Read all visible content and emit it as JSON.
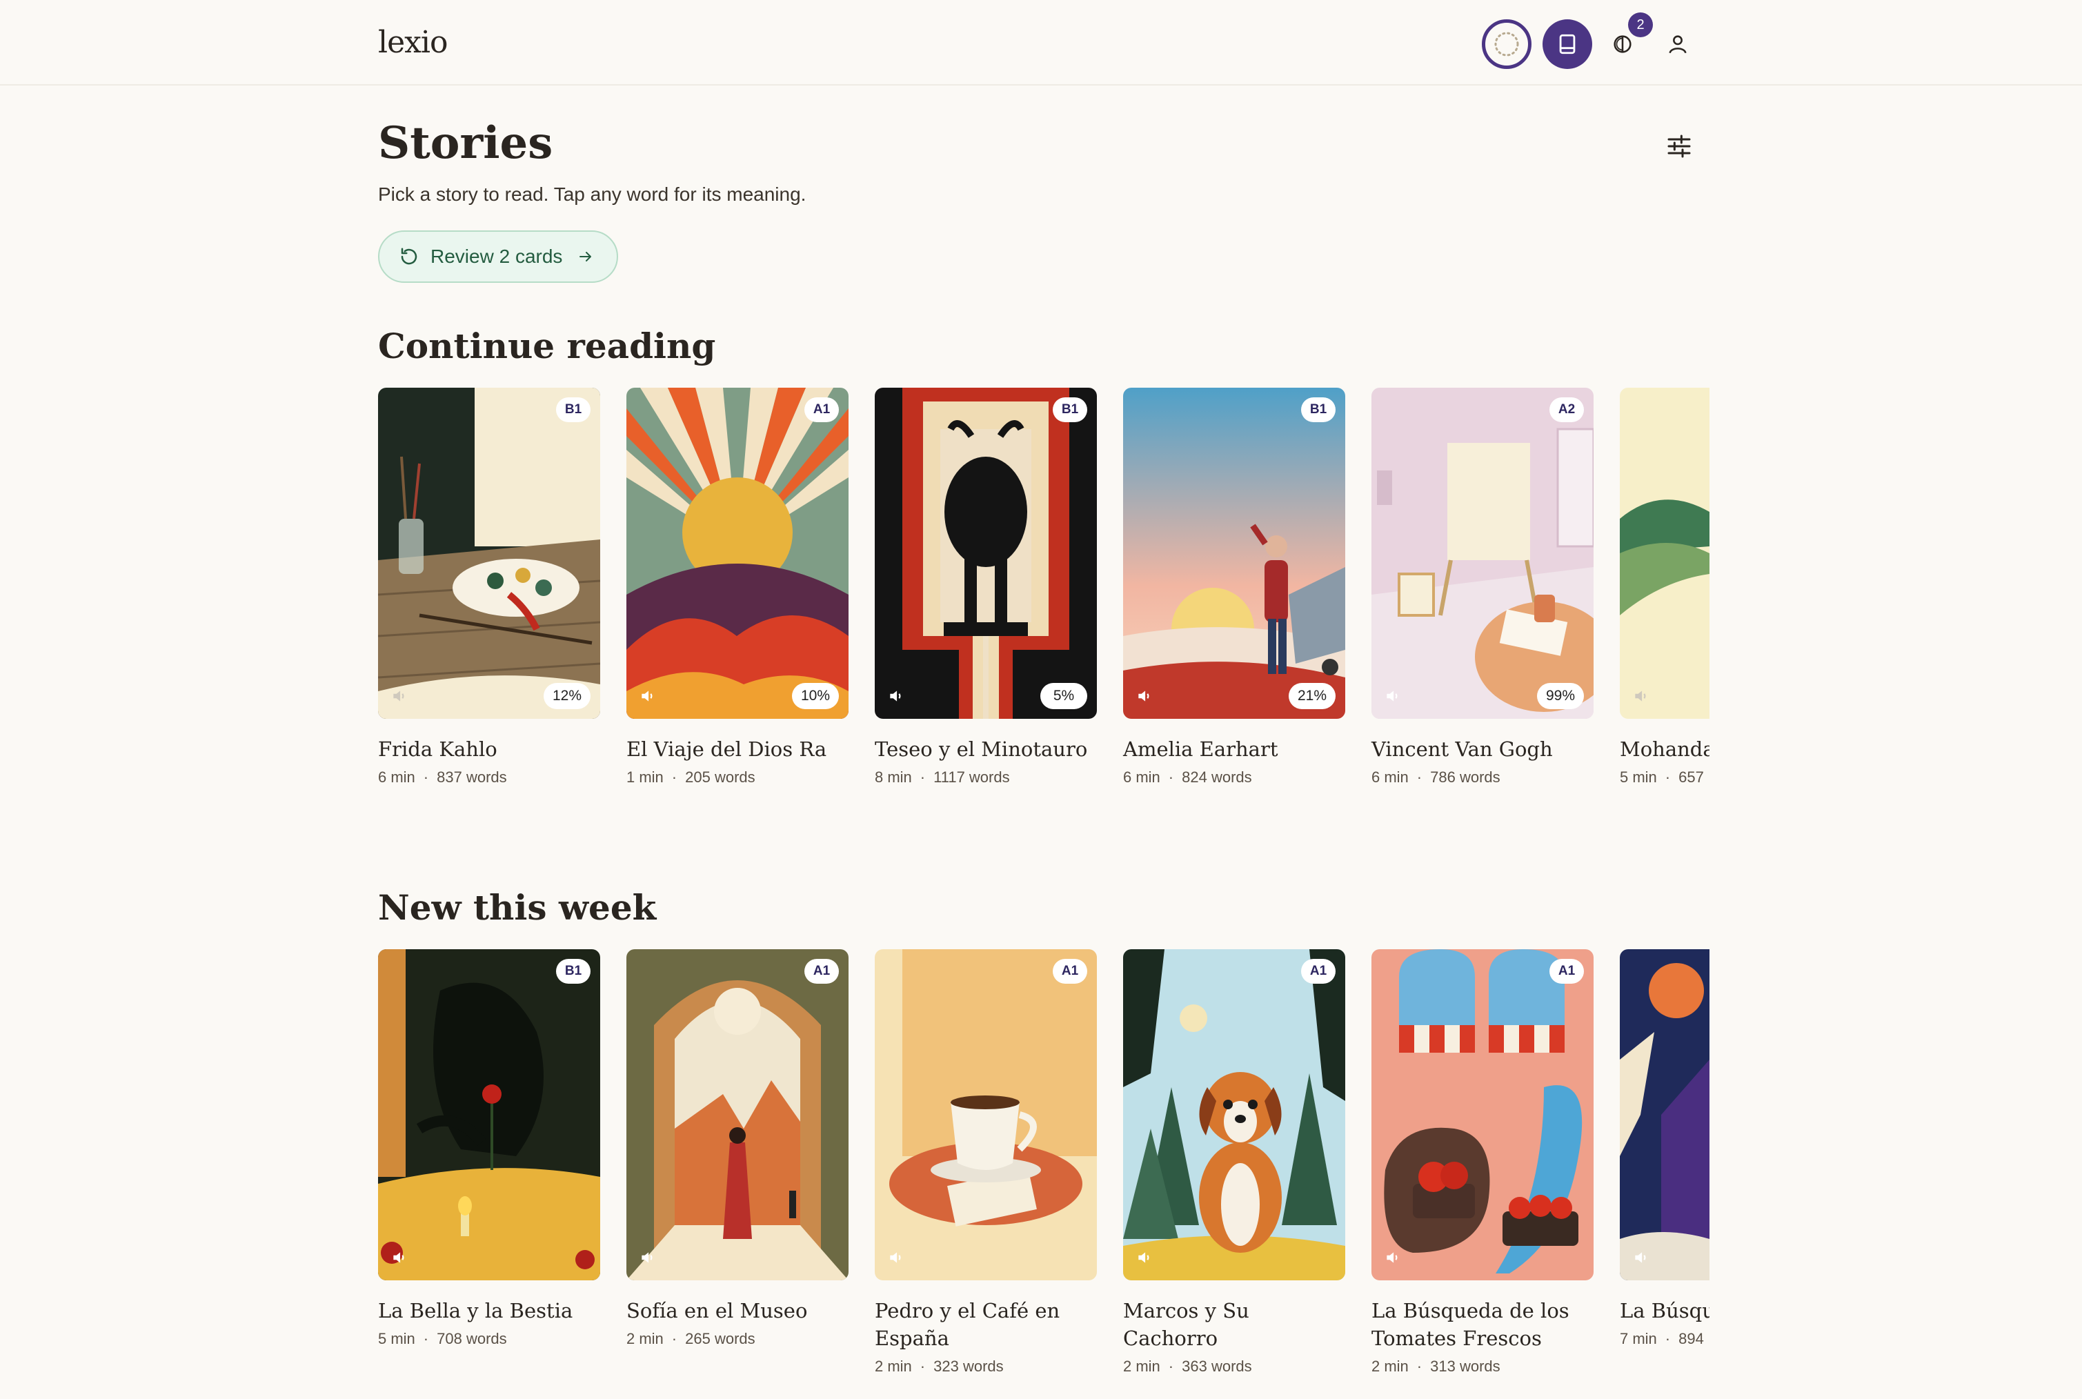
{
  "app": {
    "logo": "lexio",
    "notification_count": "2"
  },
  "header": {
    "title": "Stories",
    "subtitle": "Pick a story to read. Tap any word for its meaning.",
    "review_label": "Review 2 cards"
  },
  "sections": {
    "continue_title": "Continue reading",
    "new_title": "New this week"
  },
  "continue_reading": [
    {
      "title": "Frida Kahlo",
      "level": "B1",
      "progress": "12%",
      "minutes": "6 min",
      "words": "837 words"
    },
    {
      "title": "El Viaje del Dios Ra",
      "level": "A1",
      "progress": "10%",
      "minutes": "1 min",
      "words": "205 words"
    },
    {
      "title": "Teseo y el Minotauro",
      "level": "B1",
      "progress": "5%",
      "minutes": "8 min",
      "words": "1117 words"
    },
    {
      "title": "Amelia Earhart",
      "level": "B1",
      "progress": "21%",
      "minutes": "6 min",
      "words": "824 words"
    },
    {
      "title": "Vincent Van Gogh",
      "level": "A2",
      "progress": "99%",
      "minutes": "6 min",
      "words": "786 words"
    },
    {
      "title": "Mohandas",
      "level": "",
      "progress": "",
      "minutes": "5 min",
      "words": "657"
    }
  ],
  "new_this_week": [
    {
      "title": "La Bella y la Bestia",
      "level": "B1",
      "minutes": "5 min",
      "words": "708 words"
    },
    {
      "title": "Sofía en el Museo",
      "level": "A1",
      "minutes": "2 min",
      "words": "265 words"
    },
    {
      "title": "Pedro y el Café en España",
      "level": "A1",
      "minutes": "2 min",
      "words": "323 words"
    },
    {
      "title": "Marcos y Su Cachorro",
      "level": "A1",
      "minutes": "2 min",
      "words": "363 words"
    },
    {
      "title": "La Búsqueda de los Tomates Frescos",
      "level": "A1",
      "minutes": "2 min",
      "words": "313 words"
    },
    {
      "title": "La Búsque Grial",
      "level": "",
      "minutes": "7 min",
      "words": "894"
    }
  ],
  "icons": {
    "progress_ring": "dotted-circle-icon",
    "library": "book-icon",
    "theme": "contrast-icon",
    "account": "user-icon",
    "filter": "sliders-icon",
    "review": "refresh-icon",
    "arrow": "arrow-right-icon",
    "audio": "speaker-icon"
  },
  "colors": {
    "accent": "#4b3584",
    "review_bg": "#eaf6ef",
    "review_text": "#245c40",
    "page_bg": "#fbf9f5"
  }
}
